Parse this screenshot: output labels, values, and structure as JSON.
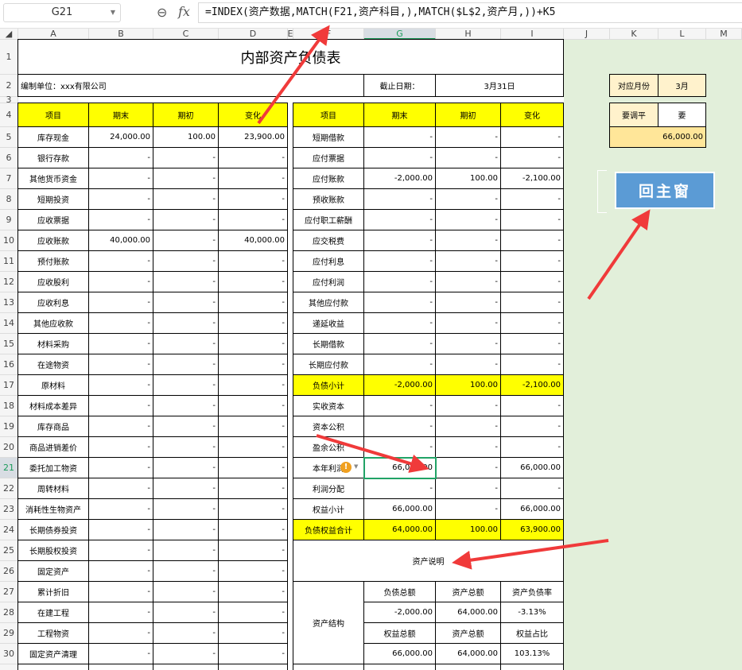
{
  "formula_bar": {
    "name_box": "G21",
    "formula": "=INDEX(资产数据,MATCH(F21,资产科目,),MATCH($L$2,资产月,))+K5"
  },
  "col_headers": [
    "A",
    "B",
    "C",
    "D",
    "E",
    "F",
    "G",
    "H",
    "I",
    "J",
    "K",
    "L",
    "M"
  ],
  "row_headers": [
    "1",
    "2",
    "3",
    "4",
    "5",
    "6",
    "7",
    "8",
    "9",
    "10",
    "11",
    "12",
    "13",
    "14",
    "15",
    "16",
    "17",
    "18",
    "19",
    "20",
    "21",
    "22",
    "23",
    "24",
    "25",
    "26",
    "27",
    "28",
    "29",
    "30"
  ],
  "sheet": {
    "title": "内部资产负债表",
    "company": "编制单位：xxx有限公司",
    "date_label": "截止日期：",
    "date_value": "3月31日",
    "headers": [
      "项目",
      "期末",
      "期初",
      "变化"
    ],
    "left_rows": [
      [
        "库存现金",
        "24,000.00",
        "100.00",
        "23,900.00"
      ],
      [
        "银行存款",
        "-",
        "-",
        "-"
      ],
      [
        "其他货币资金",
        "-",
        "-",
        "-"
      ],
      [
        "短期投资",
        "-",
        "-",
        "-"
      ],
      [
        "应收票据",
        "-",
        "-",
        "-"
      ],
      [
        "应收账款",
        "40,000.00",
        "-",
        "40,000.00"
      ],
      [
        "预付账款",
        "-",
        "-",
        "-"
      ],
      [
        "应收股利",
        "-",
        "-",
        "-"
      ],
      [
        "应收利息",
        "-",
        "-",
        "-"
      ],
      [
        "其他应收款",
        "-",
        "-",
        "-"
      ],
      [
        "材料采购",
        "-",
        "-",
        "-"
      ],
      [
        "在途物资",
        "-",
        "-",
        "-"
      ],
      [
        "原材料",
        "-",
        "-",
        "-"
      ],
      [
        "材料成本差异",
        "-",
        "-",
        "-"
      ],
      [
        "库存商品",
        "-",
        "-",
        "-"
      ],
      [
        "商品进销差价",
        "-",
        "-",
        "-"
      ],
      [
        "委托加工物资",
        "-",
        "-",
        "-"
      ],
      [
        "周转材料",
        "-",
        "-",
        "-"
      ],
      [
        "消耗性生物资产",
        "-",
        "-",
        "-"
      ],
      [
        "长期债券投资",
        "-",
        "-",
        "-"
      ],
      [
        "长期股权投资",
        "-",
        "-",
        "-"
      ],
      [
        "固定资产",
        "-",
        "-",
        "-"
      ],
      [
        "累计折旧",
        "-",
        "-",
        "-"
      ],
      [
        "在建工程",
        "-",
        "-",
        "-"
      ],
      [
        "工程物资",
        "-",
        "-",
        "-"
      ],
      [
        "固定资产清理",
        "-",
        "-",
        "-"
      ]
    ],
    "right_rows": [
      [
        "短期借款",
        "-",
        "-",
        "-"
      ],
      [
        "应付票据",
        "-",
        "-",
        "-"
      ],
      [
        "应付账款",
        "-2,000.00",
        "100.00",
        "-2,100.00"
      ],
      [
        "预收账款",
        "-",
        "-",
        "-"
      ],
      [
        "应付职工薪酬",
        "-",
        "-",
        "-"
      ],
      [
        "应交税费",
        "-",
        "-",
        "-"
      ],
      [
        "应付利息",
        "-",
        "-",
        "-"
      ],
      [
        "应付利润",
        "-",
        "-",
        "-"
      ],
      [
        "其他应付款",
        "-",
        "-",
        "-"
      ],
      [
        "递延收益",
        "-",
        "-",
        "-"
      ],
      [
        "长期借款",
        "-",
        "-",
        "-"
      ],
      [
        "长期应付款",
        "-",
        "-",
        "-"
      ],
      [
        "负债小计",
        "-2,000.00",
        "100.00",
        "-2,100.00"
      ],
      [
        "实收资本",
        "-",
        "-",
        "-"
      ],
      [
        "资本公积",
        "-",
        "-",
        "-"
      ],
      [
        "盈余公积",
        "-",
        "-",
        "-"
      ],
      [
        "本年利润",
        "66,000.00",
        "-",
        "66,000.00"
      ],
      [
        "利润分配",
        "-",
        "-",
        "-"
      ],
      [
        "权益小计",
        "66,000.00",
        "-",
        "66,000.00"
      ],
      [
        "负债权益合计",
        "64,000.00",
        "100.00",
        "63,900.00"
      ]
    ],
    "note": "资产说明",
    "structure": {
      "label": "资产结构",
      "rows": [
        [
          "负债总额",
          "资产总额",
          "资产负债率"
        ],
        [
          "-2,000.00",
          "64,000.00",
          "-3.13%"
        ],
        [
          "权益总额",
          "资产总额",
          "权益占比"
        ],
        [
          "66,000.00",
          "64,000.00",
          "103.13%"
        ]
      ]
    }
  },
  "side_panel": {
    "month_label": "对应月份",
    "month_value": "3月",
    "balance_label": "要调平",
    "balance_value": "要",
    "balance_amount": "66,000.00",
    "main_button": "回主窗"
  },
  "colors": {
    "yellow": "#ffff00",
    "cream": "#fff2cc",
    "gold": "#ffe699",
    "green_bg": "#e2efda",
    "button": "#5b9bd5",
    "selection": "#21a366",
    "arrow": "#f03a3a"
  }
}
